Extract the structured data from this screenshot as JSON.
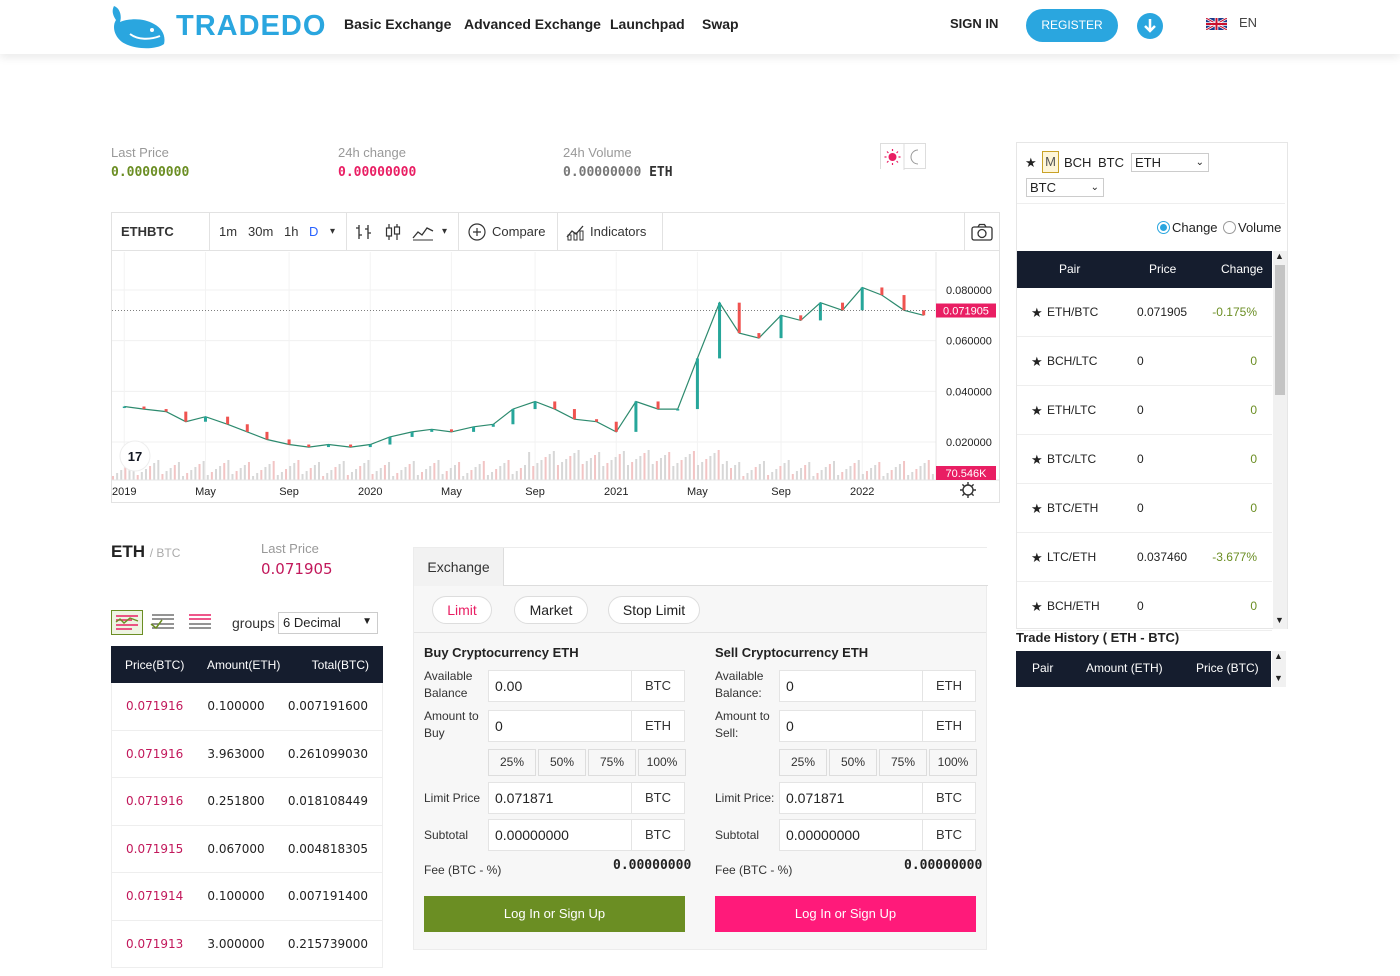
{
  "header": {
    "logo_text": "TRADEDO",
    "nav": [
      "Basic Exchange",
      "Advanced Exchange",
      "Launchpad",
      "Swap"
    ],
    "sign_in": "SIGN IN",
    "register": "REGISTER",
    "language": "EN"
  },
  "stats": {
    "last_price_label": "Last Price",
    "last_price_value": "0.00000000",
    "change_label": "24h change",
    "change_value": "0.00000000",
    "volume_label": "24h Volume",
    "volume_value": "0.00000000",
    "volume_unit": "ETH"
  },
  "chart_toolbar": {
    "symbol": "ETHBTC",
    "intervals": [
      "1m",
      "30m",
      "1h",
      "D"
    ],
    "compare": "Compare",
    "indicators": "Indicators"
  },
  "chart_data": {
    "type": "line",
    "title": "",
    "x_tick_labels": [
      "2019",
      "May",
      "Sep",
      "2020",
      "May",
      "Sep",
      "2021",
      "May",
      "Sep",
      "2022"
    ],
    "y_tick_labels": [
      "0.080000",
      "0.060000",
      "0.040000",
      "0.020000"
    ],
    "ylim": [
      0.005,
      0.095
    ],
    "last_price_label": "0.071905",
    "volume_label": "70.546K",
    "series": [
      {
        "x": [
          2019.0,
          2019.08,
          2019.17,
          2019.25,
          2019.33,
          2019.42,
          2019.5,
          2019.58,
          2019.67,
          2019.75,
          2019.83,
          2019.92,
          2020.0,
          2020.08,
          2020.17,
          2020.25,
          2020.33,
          2020.42,
          2020.5,
          2020.58,
          2020.67,
          2020.75,
          2020.83,
          2020.92,
          2021.0,
          2021.08,
          2021.17,
          2021.25,
          2021.33,
          2021.42,
          2021.5,
          2021.58,
          2021.67,
          2021.75,
          2021.83,
          2021.92,
          2022.0,
          2022.08,
          2022.17,
          2022.25
        ],
        "values": [
          0.034,
          0.033,
          0.032,
          0.028,
          0.03,
          0.027,
          0.024,
          0.021,
          0.019,
          0.018,
          0.019,
          0.018,
          0.019,
          0.022,
          0.024,
          0.025,
          0.024,
          0.026,
          0.027,
          0.033,
          0.036,
          0.033,
          0.029,
          0.028,
          0.024,
          0.036,
          0.033,
          0.033,
          0.053,
          0.075,
          0.063,
          0.061,
          0.07,
          0.068,
          0.075,
          0.072,
          0.081,
          0.078,
          0.072,
          0.07
        ]
      }
    ]
  },
  "order_book": {
    "pair_base": "ETH",
    "pair_quote": "BTC",
    "last_price_label": "Last Price",
    "last_price_value": "0.071905",
    "groups_label": "groups",
    "groups_value": "6 Decimal",
    "columns": [
      "Price(BTC)",
      "Amount(ETH)",
      "Total(BTC)"
    ],
    "rows": [
      [
        "0.071916",
        "0.100000",
        "0.007191600"
      ],
      [
        "0.071916",
        "3.963000",
        "0.261099030"
      ],
      [
        "0.071916",
        "0.251800",
        "0.018108449"
      ],
      [
        "0.071915",
        "0.067000",
        "0.004818305"
      ],
      [
        "0.071914",
        "0.100000",
        "0.007191400"
      ],
      [
        "0.071913",
        "3.000000",
        "0.215739000"
      ]
    ]
  },
  "exchange": {
    "tab": "Exchange",
    "order_types": [
      "Limit",
      "Market",
      "Stop Limit"
    ],
    "buy": {
      "title": "Buy Cryptocurrency ETH",
      "available_label": "Available Balance",
      "available_value": "0.00",
      "available_unit": "BTC",
      "amount_label": "Amount to Buy",
      "amount_value": "0",
      "amount_unit": "ETH",
      "limit_label": "Limit Price",
      "limit_value": "0.071871",
      "limit_unit": "BTC",
      "subtotal_label": "Subtotal",
      "subtotal_value": "0.00000000",
      "subtotal_unit": "BTC",
      "fee_label": "Fee (BTC - %)",
      "fee_value": "0.00000000",
      "button": "Log In or Sign Up"
    },
    "sell": {
      "title": "Sell Cryptocurrency ETH",
      "available_label": "Available Balance:",
      "available_value": "0",
      "available_unit": "ETH",
      "amount_label": "Amount to Sell:",
      "amount_value": "0",
      "amount_unit": "ETH",
      "limit_label": "Limit Price:",
      "limit_value": "0.071871",
      "limit_unit": "BTC",
      "subtotal_label": "Subtotal",
      "subtotal_value": "0.00000000",
      "subtotal_unit": "BTC",
      "fee_label": "Fee (BTC - %)",
      "fee_value": "0.00000000",
      "button": "Log In or Sign Up"
    },
    "percents": [
      "25%",
      "50%",
      "75%",
      "100%"
    ]
  },
  "market": {
    "tabs": [
      "M",
      "BCH",
      "BTC"
    ],
    "select1": "ETH",
    "select2": "BTC",
    "radio_change": "Change",
    "radio_volume": "Volume",
    "columns": [
      "Pair",
      "Price",
      "Change"
    ],
    "rows": [
      [
        "ETH/BTC",
        "0.071905",
        "-0.175%"
      ],
      [
        "BCH/LTC",
        "0",
        "0"
      ],
      [
        "ETH/LTC",
        "0",
        "0"
      ],
      [
        "BTC/LTC",
        "0",
        "0"
      ],
      [
        "BTC/ETH",
        "0",
        "0"
      ],
      [
        "LTC/ETH",
        "0.037460",
        "-3.677%"
      ],
      [
        "BCH/ETH",
        "0",
        "0"
      ]
    ]
  },
  "trade_history": {
    "title": "Trade History ( ETH - BTC)",
    "columns": [
      "Pair",
      "Amount (ETH)",
      "Price (BTC)"
    ]
  },
  "colors": {
    "accent": "#2aa6df",
    "buy_green": "#6b8e23",
    "sell_pink": "#ff1a7a",
    "header_dark": "#151d2e",
    "price_red": "#c2185b"
  }
}
